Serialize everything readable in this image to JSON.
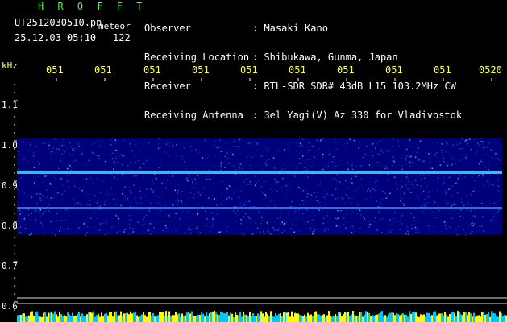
{
  "header": {
    "brand": "H R O F F T",
    "filename": "UT2512030510.pn",
    "event_type": "meteor",
    "datetime": "25.12.03 05:10",
    "count": "122"
  },
  "metadata": [
    {
      "label": "Observer",
      "value": ": Masaki Kano"
    },
    {
      "label": "Receiving Location",
      "value": ": Shibukawa, Gunma, Japan"
    },
    {
      "label": "Receiver",
      "value": ": RTL-SDR SDR# 43dB L15 103.2MHz CW"
    },
    {
      "label": "Receiving Antenna",
      "value": ": 3el Yagi(V) Az 330 for Vladivostok"
    }
  ],
  "axis": {
    "unit": "kHz",
    "time_ticks": [
      "051",
      "051",
      "051",
      "051",
      "051",
      "051",
      "051",
      "051",
      "051",
      "0520"
    ],
    "freq_labels": [
      "1.1",
      "1.0",
      "0.9",
      "0.8",
      "0.7",
      "0.6"
    ]
  },
  "colors": {
    "brand": "#3cff3c",
    "tick": "#ffff44",
    "band_dark": "#00007a",
    "band_mid": "#1e46ff",
    "trace": "#46d6ff",
    "baseline": "#dcdcdc",
    "noise_floor": "#ffff00"
  }
}
